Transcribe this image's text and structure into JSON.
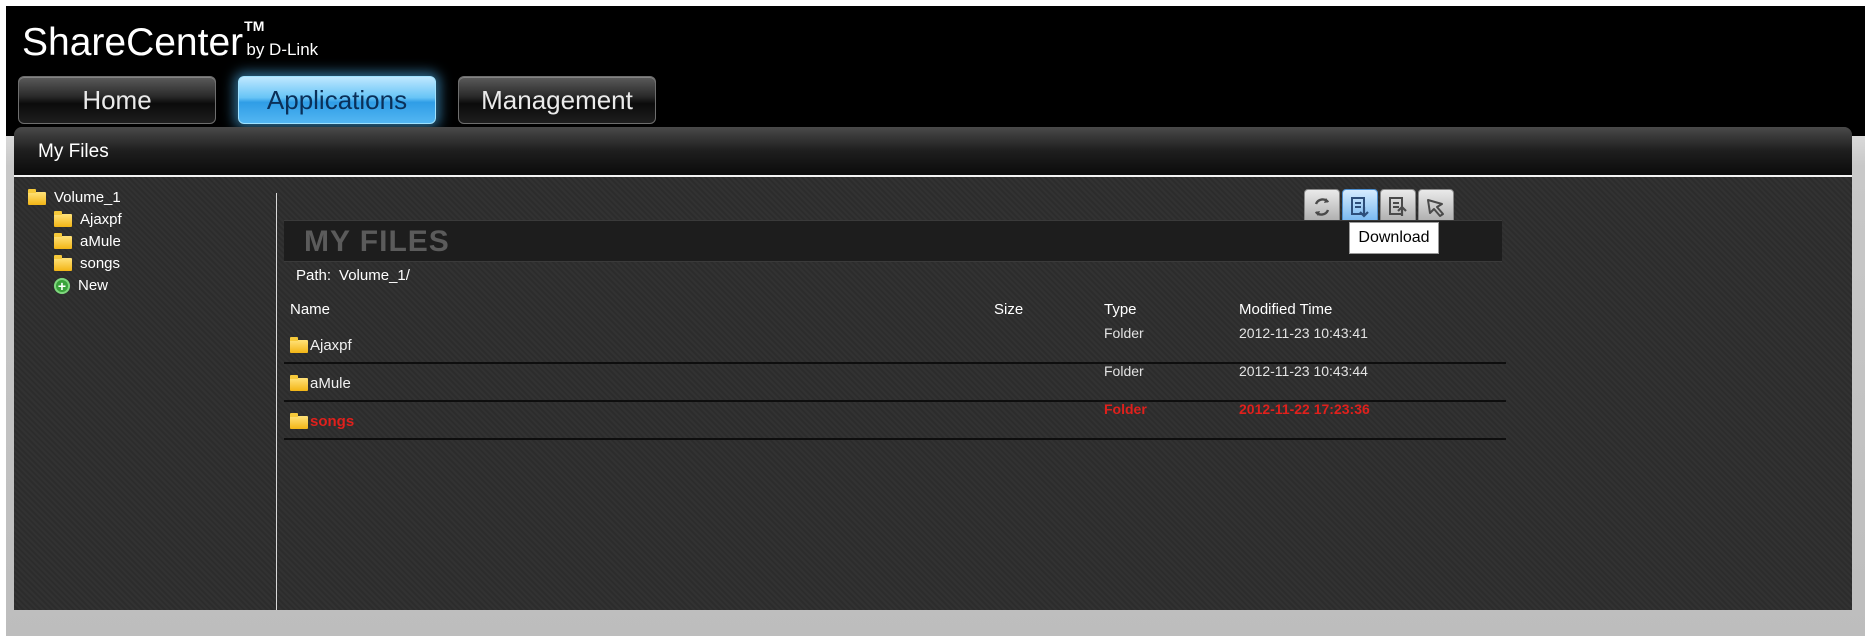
{
  "app": {
    "title": "ShareCenter",
    "tm": "TM",
    "subtitle": "by D-Link"
  },
  "nav": {
    "tabs": [
      {
        "label": "Home",
        "active": false
      },
      {
        "label": "Applications",
        "active": true
      },
      {
        "label": "Management",
        "active": false
      }
    ]
  },
  "panel": {
    "title": "My Files"
  },
  "tree": {
    "root": "Volume_1",
    "children": [
      "Ajaxpf",
      "aMule",
      "songs"
    ],
    "new_label": "New"
  },
  "toolbar": {
    "buttons": [
      {
        "icon": "refresh-icon"
      },
      {
        "icon": "download-icon",
        "active": true
      },
      {
        "icon": "upload-icon"
      },
      {
        "icon": "select-icon"
      }
    ],
    "tooltip": "Download"
  },
  "files": {
    "heading": "MY FILES",
    "path_label": "Path:",
    "path_value": "Volume_1/",
    "columns": {
      "name": "Name",
      "size": "Size",
      "type": "Type",
      "modified": "Modified Time"
    },
    "rows": [
      {
        "name": "Ajaxpf",
        "size": "",
        "type": "Folder",
        "modified": "2012-11-23 10:43:41",
        "selected": false
      },
      {
        "name": "aMule",
        "size": "",
        "type": "Folder",
        "modified": "2012-11-23 10:43:44",
        "selected": false
      },
      {
        "name": "songs",
        "size": "",
        "type": "Folder",
        "modified": "2012-11-22 17:23:36",
        "selected": true
      }
    ]
  },
  "colors": {
    "active_tab": "#4fb4f0",
    "selected_row": "#e0201c",
    "heading": "#5b5b5b"
  }
}
